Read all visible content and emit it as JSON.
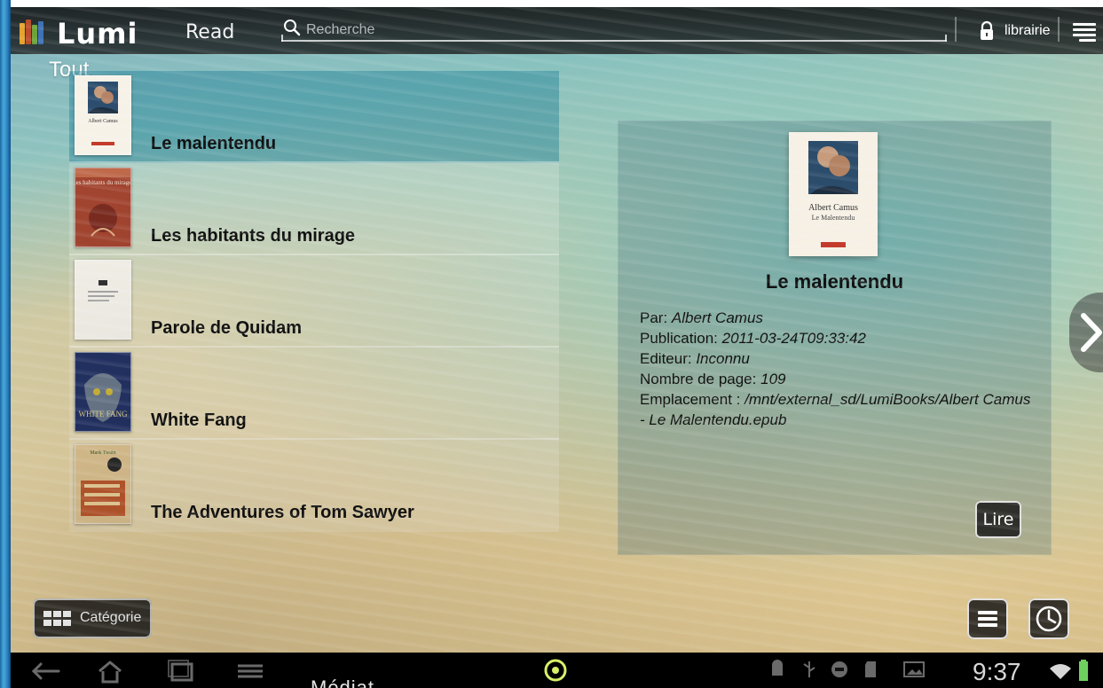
{
  "app": {
    "name": "Lumi",
    "name_suffix": "Read"
  },
  "topbar": {
    "search_placeholder": "Recherche",
    "library_label": "librairie"
  },
  "section_title": "Tout",
  "books": [
    {
      "title": "Le malentendu",
      "selected": true
    },
    {
      "title": "Les habitants du mirage",
      "selected": false
    },
    {
      "title": "Parole de Quidam",
      "selected": false
    },
    {
      "title": "White Fang",
      "selected": false
    },
    {
      "title": "The Adventures of Tom Sawyer",
      "selected": false
    }
  ],
  "thumb_text": {
    "book1": "Albert Camus",
    "book2": "les habitants du mirage",
    "book4": "WHITE FANG",
    "book5": "Mark Twain"
  },
  "details": {
    "title": "Le malentendu",
    "cover_author": "Albert Camus",
    "cover_title": "Le Malentendu",
    "by_label": "Par:",
    "by_value": "Albert Camus",
    "publication_label": "Publication:",
    "publication_value": "2011-03-24T09:33:42",
    "editor_label": "Editeur:",
    "editor_value": "Inconnu",
    "pages_label": "Nombre de page:",
    "pages_value": "109",
    "location_label": "Emplacement :",
    "location_value": "/mnt/external_sd/LumiBooks/Albert Camus - Le Malentendu.epub",
    "read_button": "Lire"
  },
  "bottom": {
    "category_label": "Catégorie"
  },
  "system": {
    "time": "9:37",
    "watermark": "Médiat"
  },
  "icons": {
    "search": "search-icon",
    "lock": "lock-icon",
    "menu": "menu-icon",
    "next": "chevron-right-icon",
    "category": "grid-icon",
    "list": "list-icon",
    "history": "clock-icon",
    "back": "back-icon",
    "home": "home-icon",
    "recents": "recent-apps-icon",
    "nav_menu": "menu-lines-icon"
  }
}
